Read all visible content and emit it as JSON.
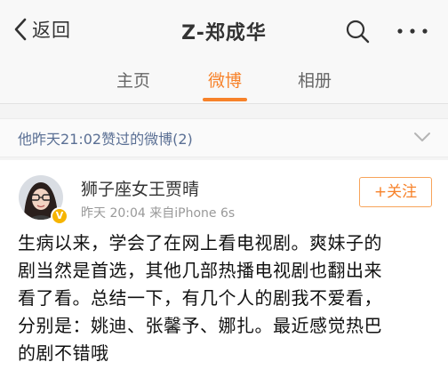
{
  "nav": {
    "back_label": "返回",
    "title": "Z-郑成华",
    "search_icon": "search-icon",
    "more_icon": "more-icon"
  },
  "tabs": [
    {
      "label": "主页",
      "active": false
    },
    {
      "label": "微博",
      "active": true
    },
    {
      "label": "相册",
      "active": false
    }
  ],
  "liked_header": {
    "label": "他昨天21:02赞过的微博(2)",
    "icon": "chevron-down-icon"
  },
  "post": {
    "username": "狮子座女王贾晴",
    "time": "昨天 20:04",
    "source": "来自iPhone 6s",
    "verified_badge": "V",
    "follow_label": "+关注",
    "content_lines": [
      "生病以来，学会了在网上看电视剧。爽妹子的",
      "剧当然是首选，其他几部热播电视剧也翻出来",
      "看了看。总结一下，有几个人的剧我不爱看，",
      "分别是：姚迪、张馨予、娜扎。最近感觉热巴",
      "的剧不错哦"
    ]
  },
  "colors": {
    "accent": "#f7822a",
    "link": "#5a6f94",
    "verified": "#f6b400"
  }
}
